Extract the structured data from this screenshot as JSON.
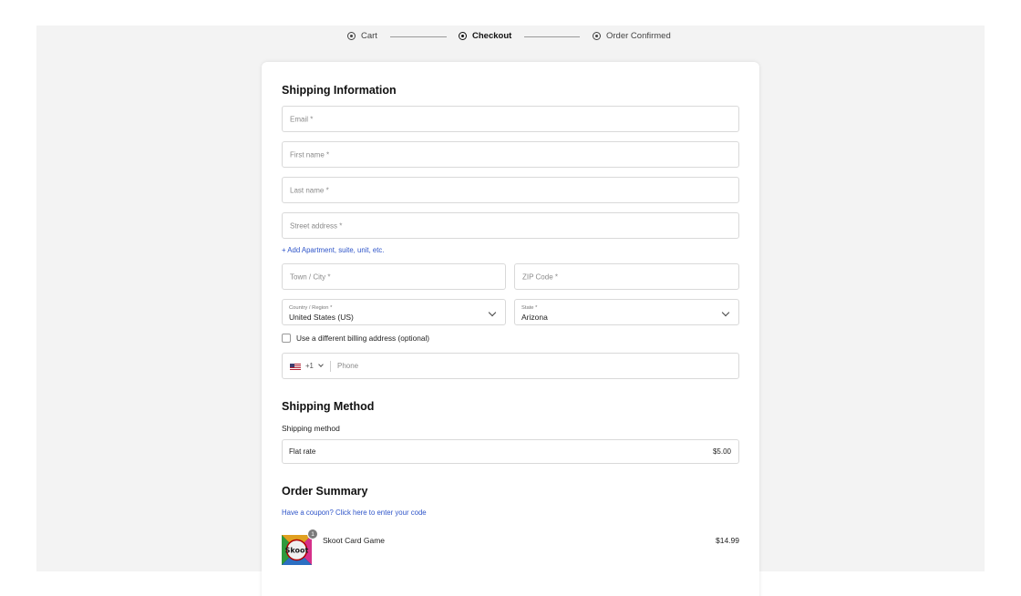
{
  "steps": [
    {
      "label": "Cart"
    },
    {
      "label": "Checkout"
    },
    {
      "label": "Order Confirmed"
    }
  ],
  "shipping_info": {
    "title": "Shipping Information",
    "email_placeholder": "Email *",
    "first_name_placeholder": "First name *",
    "last_name_placeholder": "Last name *",
    "street_placeholder": "Street address *",
    "add_apartment_link": "+ Add Apartment, suite, unit, etc.",
    "city_placeholder": "Town / City *",
    "zip_placeholder": "ZIP Code *",
    "country_label": "Country / Region *",
    "country_value": "United States (US)",
    "state_label": "State *",
    "state_value": "Arizona",
    "billing_checkbox_label": "Use a different billing address (optional)",
    "phone_country_code": "+1",
    "phone_placeholder": "Phone",
    "flag_icon": "us-flag-icon"
  },
  "shipping_method": {
    "title": "Shipping Method",
    "label": "Shipping method",
    "option_name": "Flat rate",
    "option_price": "$5.00"
  },
  "order_summary": {
    "title": "Order Summary",
    "coupon_link": "Have a coupon? Click here to enter your code",
    "items": [
      {
        "name": "Skoot Card Game",
        "price": "$14.99",
        "quantity": "1",
        "thumb_text": "Skoot"
      }
    ]
  },
  "colors": {
    "link": "#2f55c9",
    "border": "#d9d9d9",
    "background_panel": "#f3f3f3"
  }
}
